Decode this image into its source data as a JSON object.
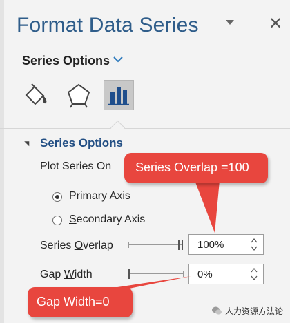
{
  "pane": {
    "title": "Format Data Series",
    "pane_options_icon": "chevron-down-icon",
    "close_icon": "close-icon"
  },
  "options_dropdown": {
    "label": "Series Options",
    "icon": "chevron-down-icon"
  },
  "category_tabs": [
    {
      "name": "Fill & Line",
      "icon": "paint-bucket-icon",
      "selected": false
    },
    {
      "name": "Effects",
      "icon": "pentagon-icon",
      "selected": false
    },
    {
      "name": "Series Options",
      "icon": "bar-chart-icon",
      "selected": true
    }
  ],
  "section": {
    "title": "Series Options",
    "expanded": true
  },
  "plot_series_on": {
    "label": "Plot Series On",
    "options": [
      {
        "label": "Primary Axis",
        "selected": true
      },
      {
        "label": "Secondary Axis",
        "selected": false
      }
    ]
  },
  "series_overlap": {
    "label": "Series Overlap",
    "value": "100%",
    "slider_level_percent": 100
  },
  "gap_width": {
    "label": "Gap Width",
    "value": "0%",
    "slider_level_percent": 0
  },
  "callouts": {
    "overlap": "Series Overlap =100",
    "gap": "Gap Width=0",
    "color": "#e8463e"
  },
  "watermark": {
    "text": "人力资源方法论",
    "icon": "wechat-icon"
  },
  "colors": {
    "title": "#2f5d8a",
    "section_title": "#234f84",
    "pane_background": "#f3f3f3"
  }
}
